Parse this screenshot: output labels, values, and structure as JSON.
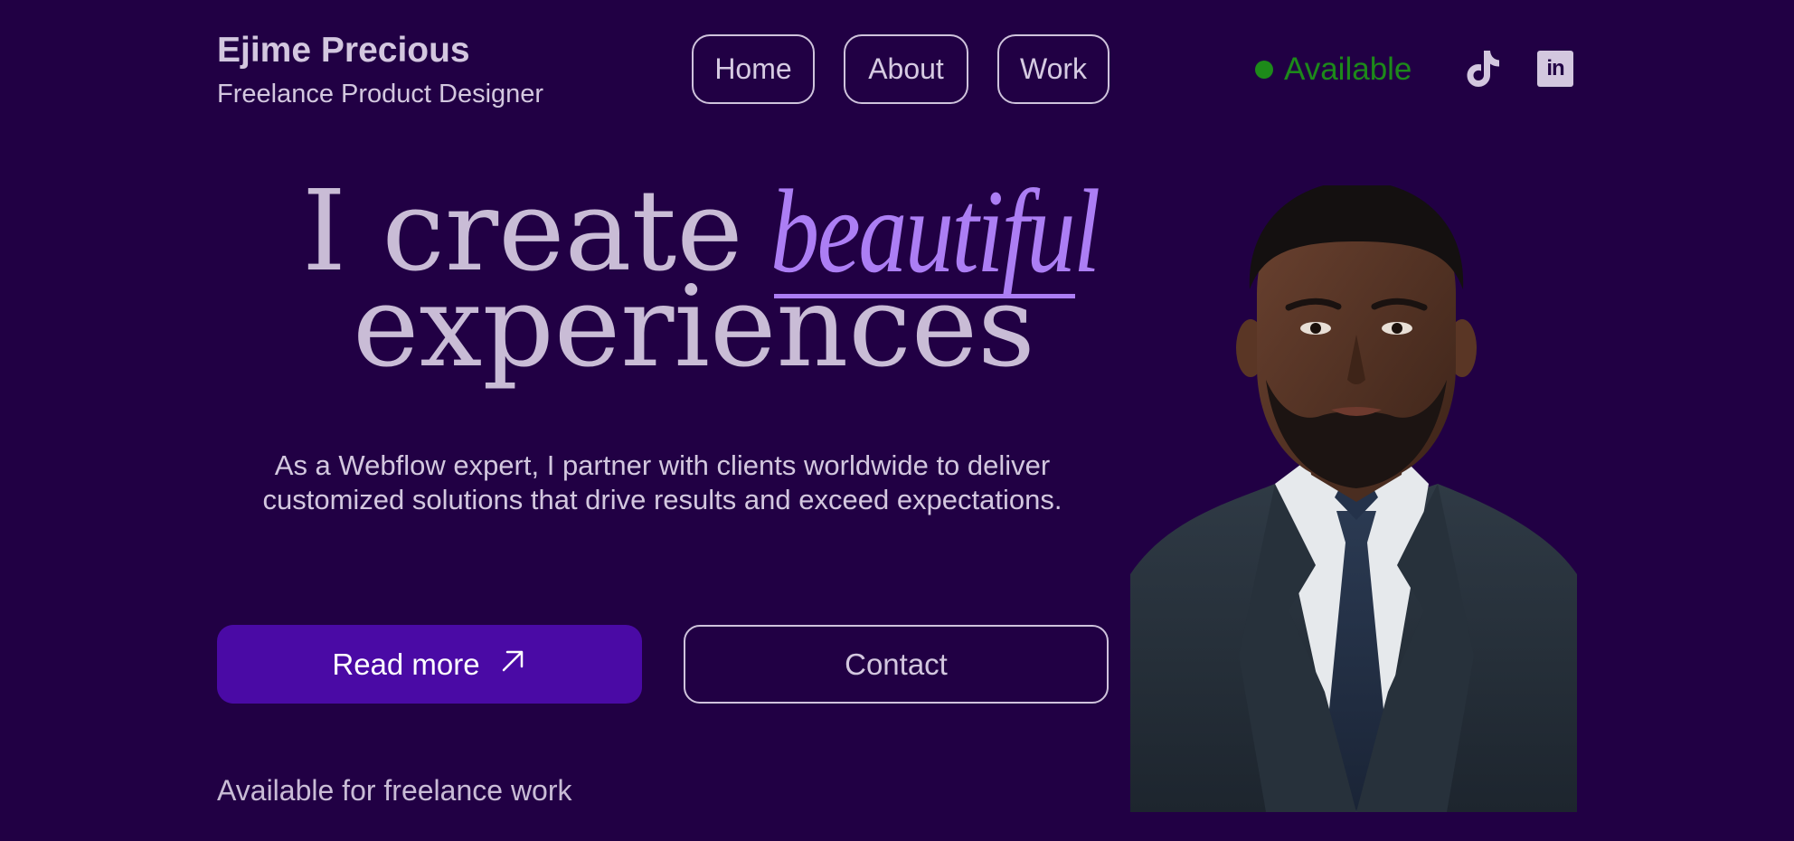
{
  "header": {
    "brand_name": "Ejime Precious",
    "brand_subtitle": "Freelance Product Designer",
    "nav": [
      {
        "label": "Home"
      },
      {
        "label": "About"
      },
      {
        "label": "Work"
      }
    ],
    "status": {
      "label": "Available",
      "color": "#1d8a1a"
    },
    "social": {
      "tiktok_icon": "tiktok-icon",
      "linkedin_icon": "linkedin-icon",
      "linkedin_text": "in"
    }
  },
  "hero": {
    "heading_part1": "I create",
    "heading_accent": "beautiful",
    "heading_part2": "experiences",
    "description": "As a Webflow expert, I partner with clients worldwide to deliver customized solutions that drive results and exceed expectations.",
    "primary_button": "Read more",
    "primary_button_icon": "arrow-up-right-icon",
    "secondary_button": "Contact",
    "footer_note": "Available for freelance work"
  },
  "portrait": {
    "alt": "Portrait of a man in a dark suit and navy tie"
  },
  "colors": {
    "background": "#210044",
    "accent": "#ac7ef4",
    "primary_button": "#4a0aa5",
    "text": "#c9bcd6"
  }
}
